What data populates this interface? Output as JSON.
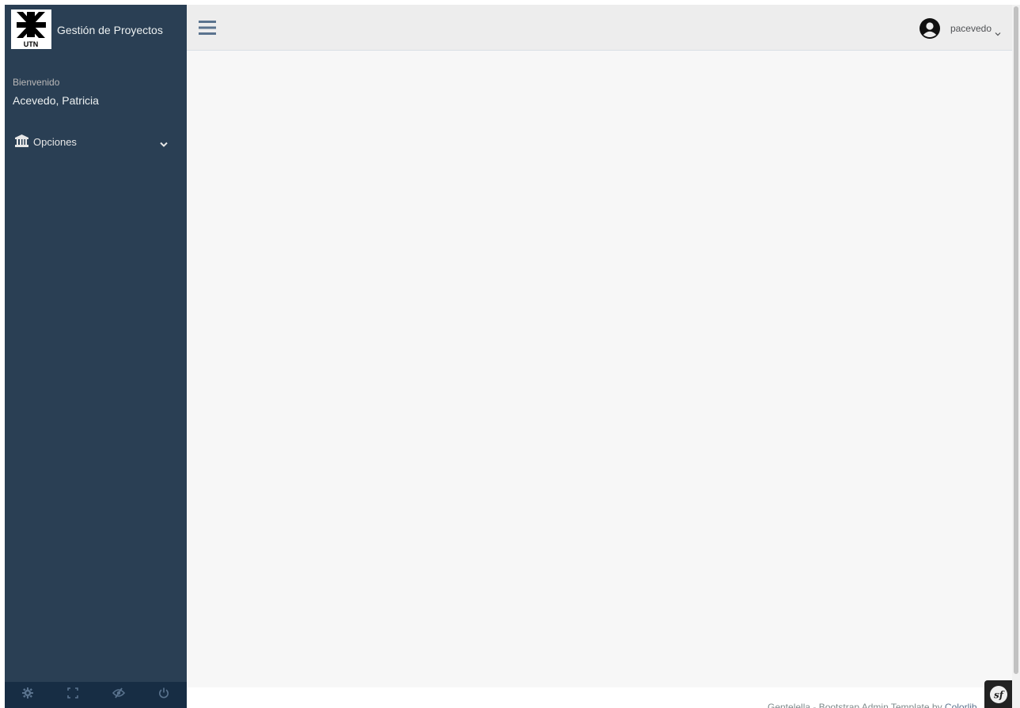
{
  "brand": {
    "logo_text": "UTN",
    "title": "Gestión de Proyectos"
  },
  "profile": {
    "welcome": "Bienvenido",
    "full_name": "Acevedo, Patricia"
  },
  "sidebar": {
    "menu": [
      {
        "label": "Opciones",
        "icon": "institution-icon",
        "expanded": false
      }
    ],
    "footer_buttons": [
      {
        "icon": "gear-icon",
        "title": "Settings"
      },
      {
        "icon": "fullscreen-icon",
        "title": "FullScreen"
      },
      {
        "icon": "eye-slash-icon",
        "title": "Lock"
      },
      {
        "icon": "power-icon",
        "title": "Logout"
      }
    ]
  },
  "topnav": {
    "username": "pacevedo"
  },
  "footer": {
    "text": "Gentelella - Bootstrap Admin Template by ",
    "link": "Colorlib"
  },
  "colors": {
    "sidebar_bg": "#2A3F54",
    "sidebar_footer_bg": "#172D44",
    "content_bg": "#F7F7F7",
    "topnav_bg": "#EDEDED",
    "accent": "#5A738E"
  }
}
